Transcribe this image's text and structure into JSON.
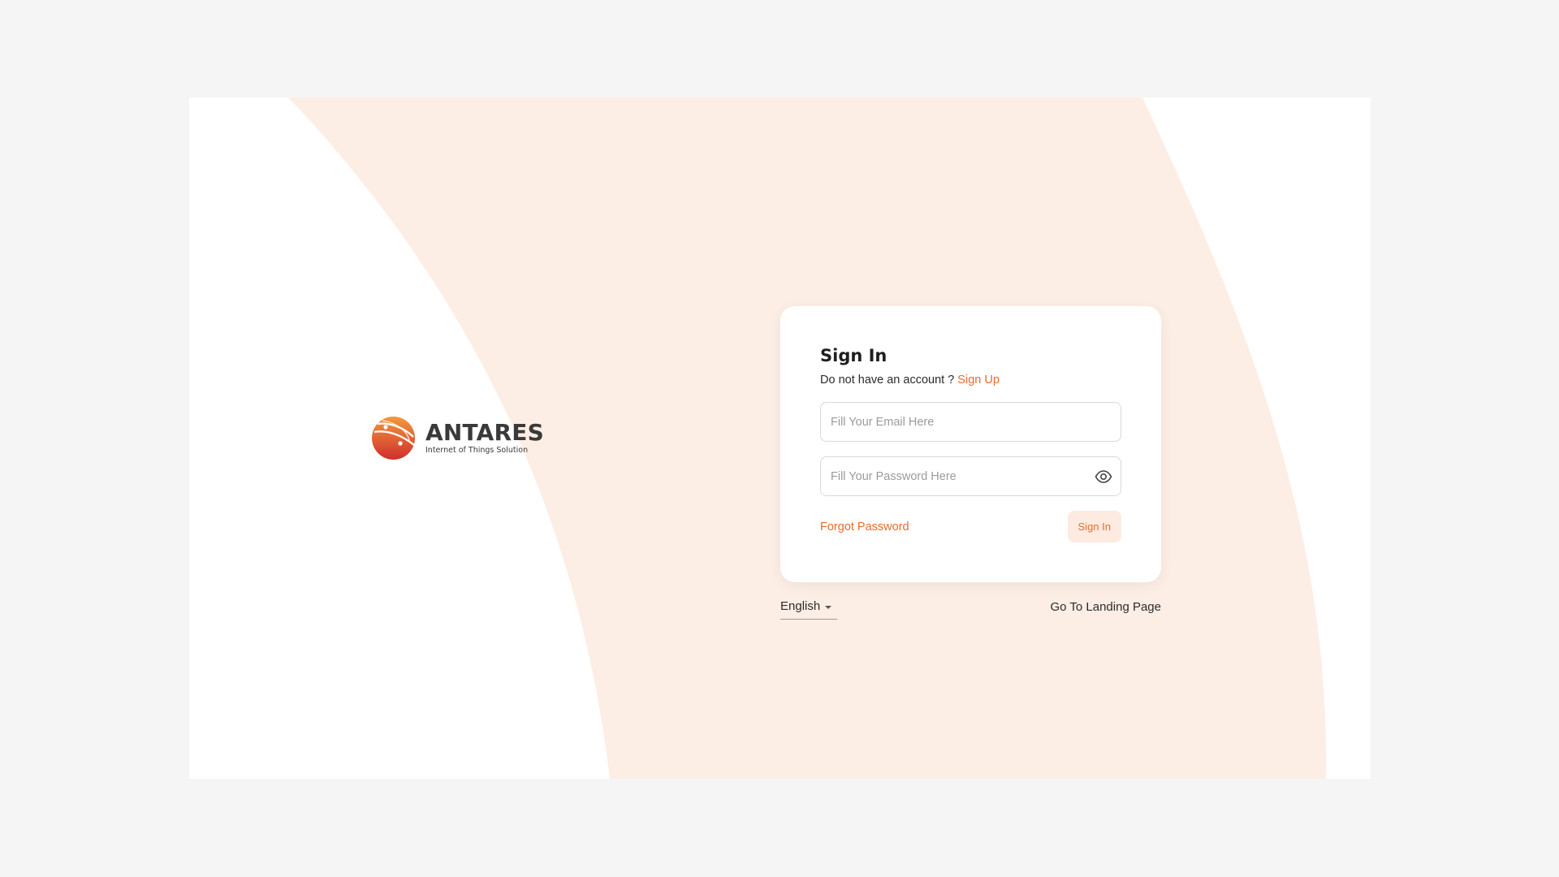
{
  "brand": {
    "name": "ANTARES",
    "tagline": "Internet of Things Solution",
    "accent": "#ea6a2c",
    "band_color": "#fdeee5"
  },
  "signin": {
    "title": "Sign In",
    "no_account_text": "Do not have an account ?",
    "signup_link": "Sign Up",
    "email_placeholder": "Fill Your Email Here",
    "password_placeholder": "Fill Your Password Here",
    "forgot_password": "Forgot Password",
    "submit_label": "Sign In"
  },
  "footer": {
    "language": "English",
    "landing_link": "Go To Landing Page"
  },
  "icons": {
    "password_toggle": "eye-icon",
    "language_dropdown": "caret-down-icon",
    "logo": "globe-logo-icon"
  }
}
